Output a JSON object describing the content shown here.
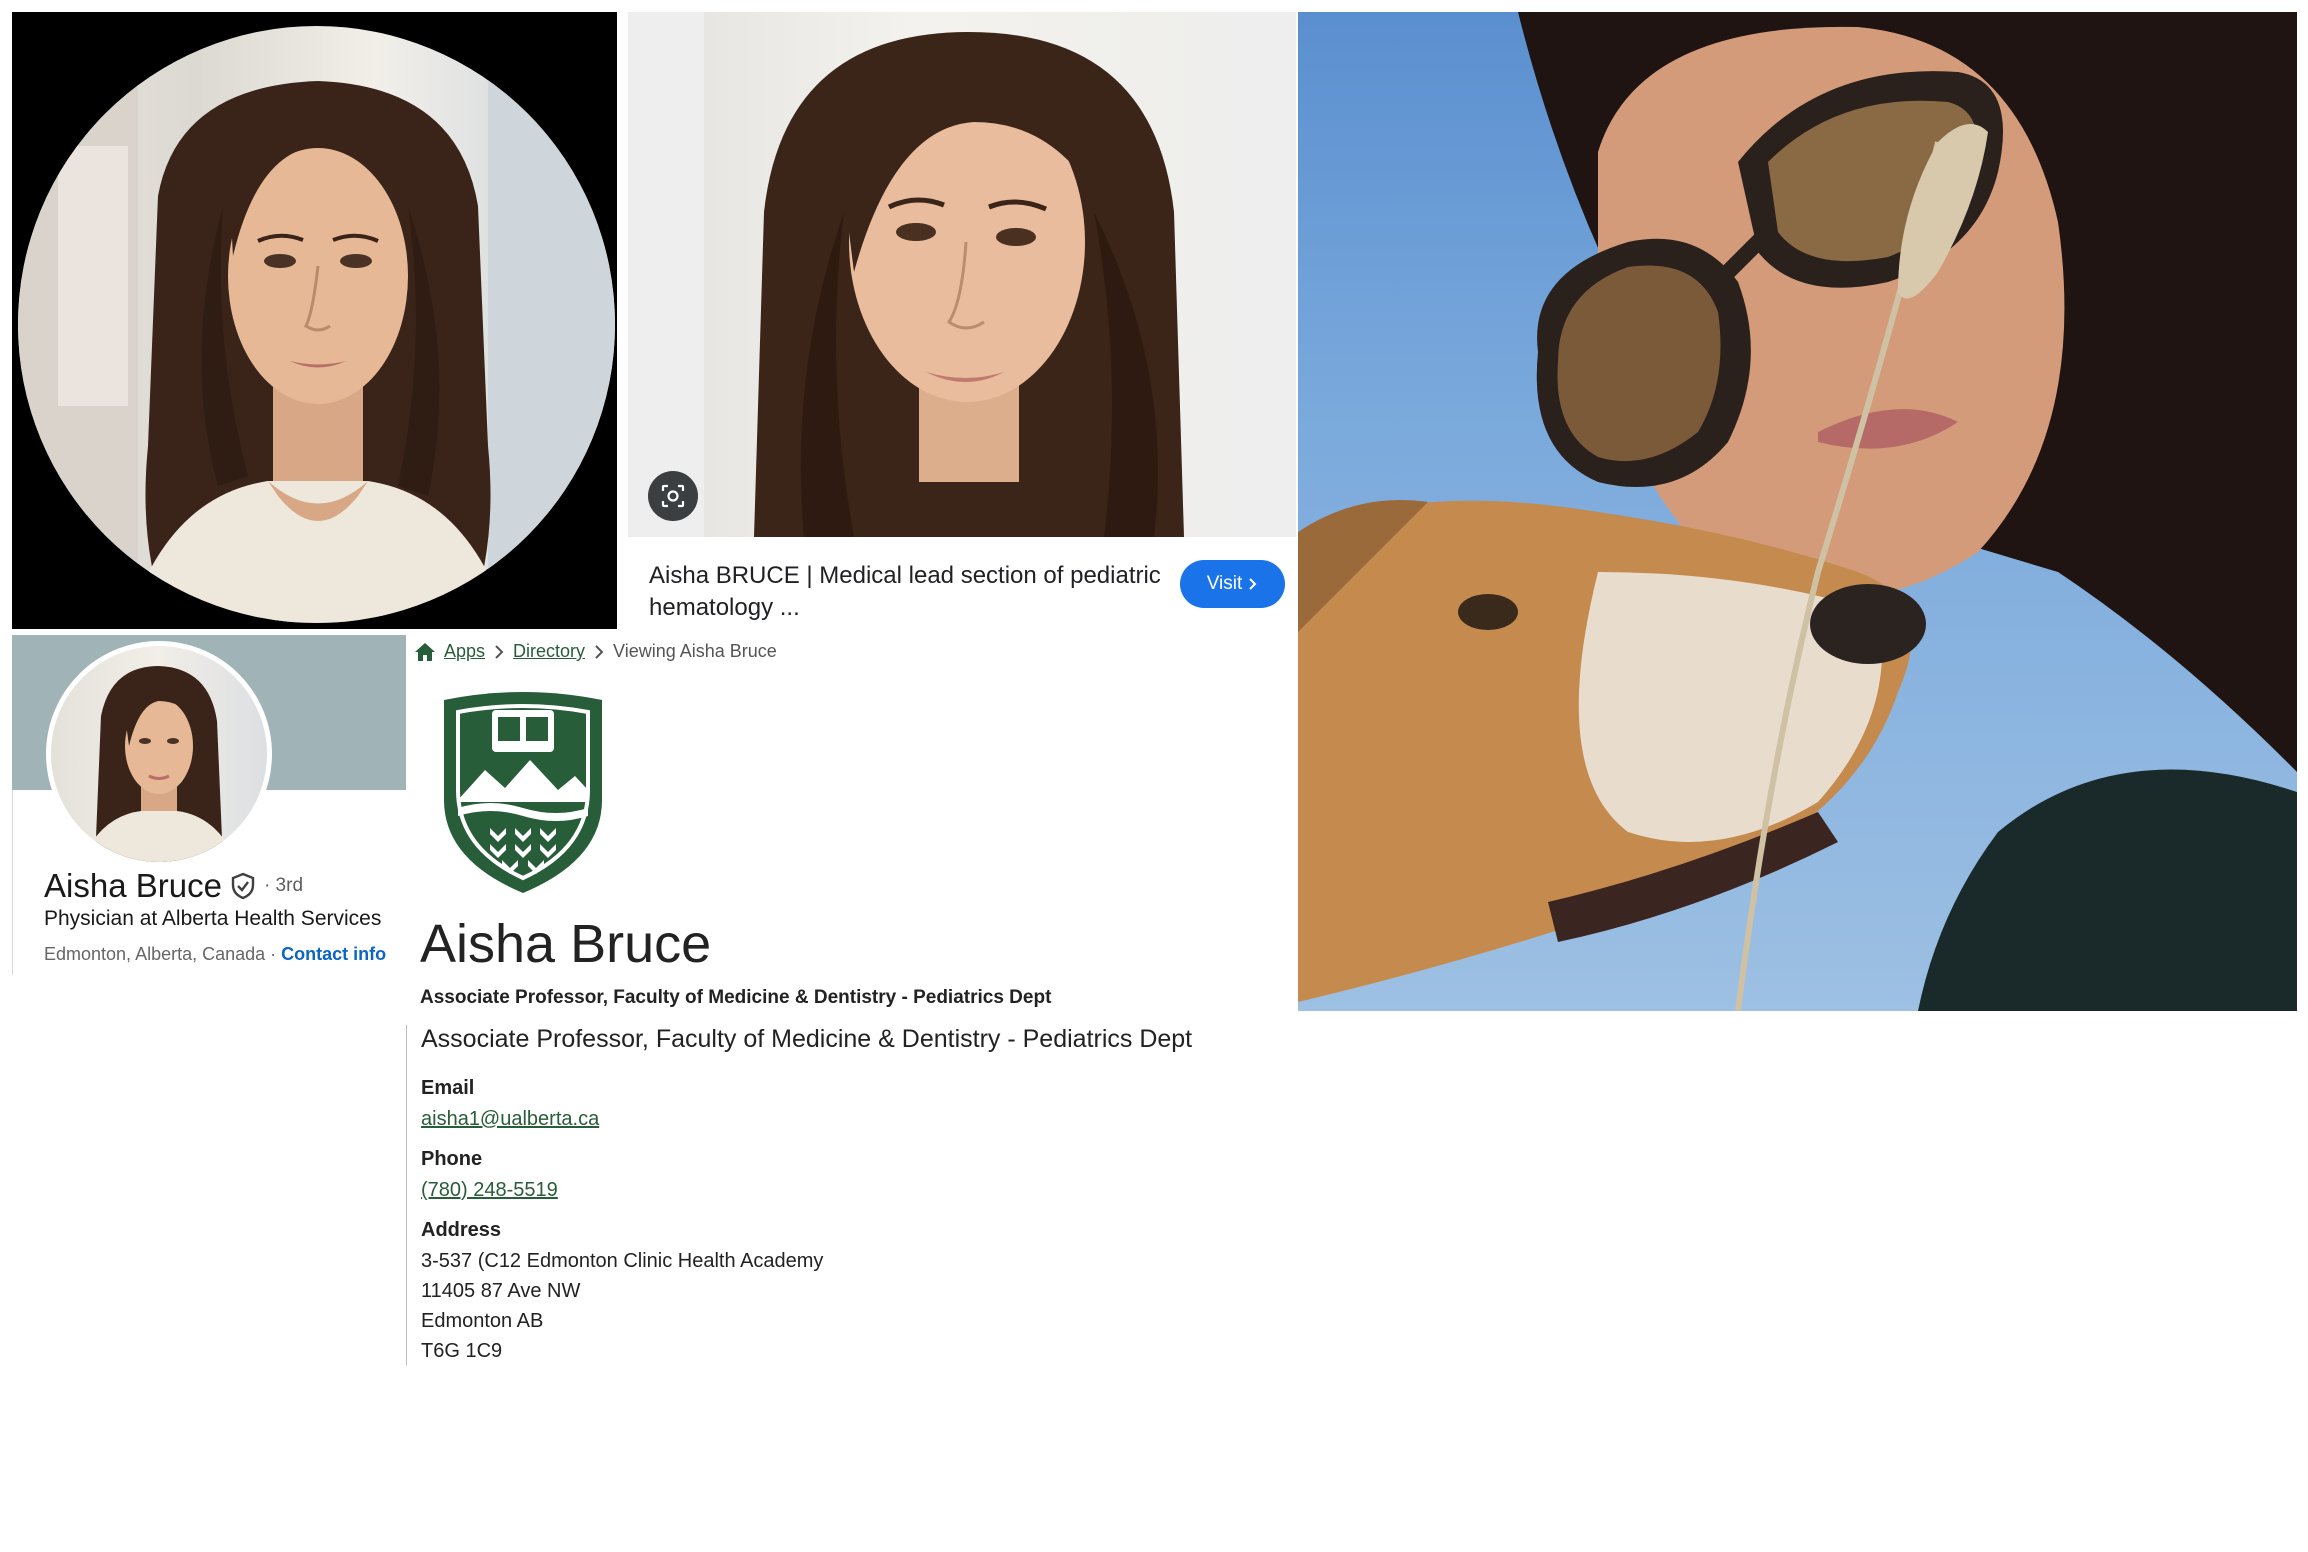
{
  "image_search": {
    "caption": "Aisha BRUCE | Medical lead section of pediatric hematology ...",
    "visit_label": "Visit"
  },
  "linkedin": {
    "name": "Aisha Bruce",
    "degree": "· 3rd",
    "headline": "Physician at Alberta Health Services",
    "location": "Edmonton, Alberta, Canada ·",
    "contact_label": "Contact info"
  },
  "directory": {
    "breadcrumb": [
      "Apps",
      "Directory",
      "Viewing Aisha Bruce"
    ],
    "name": "Aisha Bruce",
    "subtitle": "Associate Professor, Faculty of Medicine & Dentistry - Pediatrics Dept",
    "position_title": "Associate Professor, Faculty of Medicine & Dentistry - Pediatrics Dept",
    "email_label": "Email",
    "email": "aisha1@ualberta.ca",
    "phone_label": "Phone",
    "phone": "(780) 248-5519",
    "address_label": "Address",
    "address_lines": [
      "3-537 (C12 Edmonton Clinic Health Academy",
      "11405 87 Ave NW",
      "Edmonton AB",
      "T6G 1C9"
    ],
    "brand_color": "#275d38"
  },
  "icons": [
    "home-icon",
    "chevron-right-icon",
    "verified-shield-icon",
    "lens-icon",
    "university-crest-icon"
  ]
}
